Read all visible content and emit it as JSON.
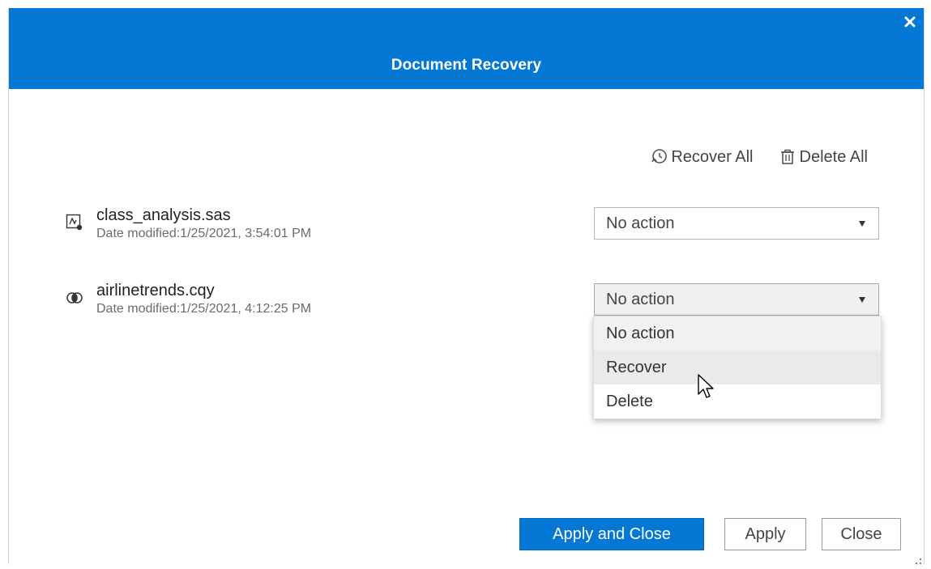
{
  "dialog": {
    "title": "Document Recovery",
    "close_icon": "close-icon"
  },
  "bulk_actions": {
    "recover_all": {
      "label": "Recover All",
      "icon": "recover-icon"
    },
    "delete_all": {
      "label": "Delete All",
      "icon": "trash-icon"
    }
  },
  "documents": [
    {
      "name": "class_analysis.sas",
      "date": "Date modified:1/25/2021, 3:54:01 PM",
      "icon": "sas-program-icon",
      "action": "No action"
    },
    {
      "name": "airlinetrends.cqy",
      "date": "Date modified:1/25/2021, 4:12:25 PM",
      "icon": "query-icon",
      "action": "No action"
    }
  ],
  "dropdown": {
    "options": [
      "No action",
      "Recover",
      "Delete"
    ],
    "selected": "No action",
    "hovered": "Recover"
  },
  "buttons": {
    "apply_and_close": "Apply and Close",
    "apply": "Apply",
    "close": "Close"
  },
  "colors": {
    "accent": "#0478d4",
    "title_text": "#ffffff"
  }
}
